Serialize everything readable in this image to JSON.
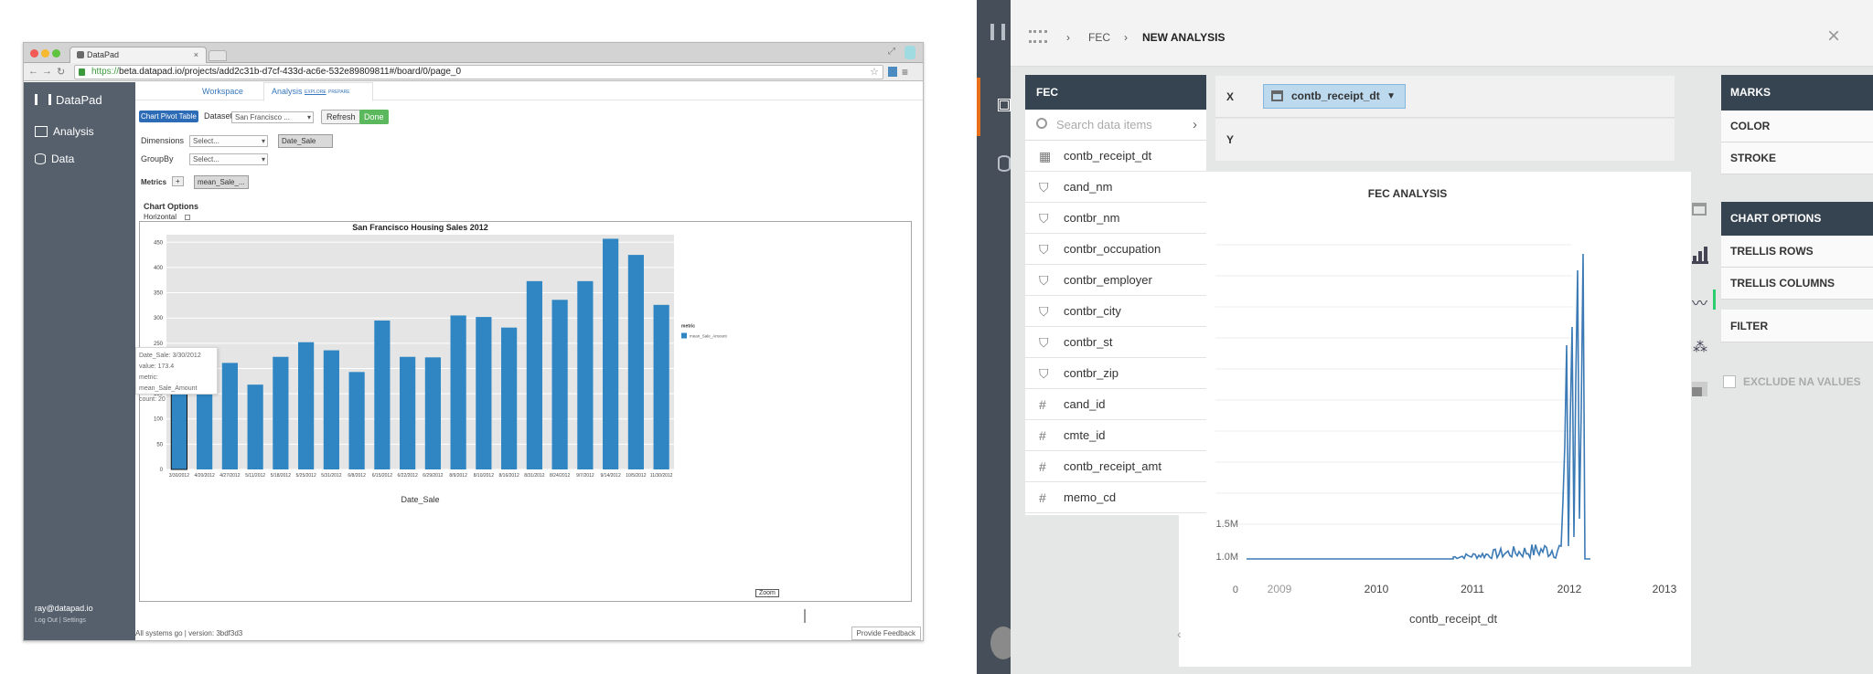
{
  "browser": {
    "tab_title": "DataPad",
    "url_prefix": "https://",
    "url": "beta.datapad.io/projects/add2c31b-d7cf-433d-ac6e-532e89809811#/board/0/page_0"
  },
  "datapad": {
    "logo_text": "DataPad",
    "nav": [
      {
        "label": "Analysis",
        "icon": "chart-icon"
      },
      {
        "label": "Data",
        "icon": "database-icon"
      }
    ],
    "tabs": {
      "workspace": "Workspace",
      "analysis": "Analysis",
      "explore": "EXPLORE",
      "prepare": "PREPARE"
    },
    "mode": {
      "chart_pivot_table": "Chart Pivot Table",
      "dataset_label": "Dataset",
      "dataset_value": "San Francisco ...",
      "refresh": "Refresh",
      "done": "Done"
    },
    "dimensions": {
      "label": "Dimensions",
      "select": "Select...",
      "chip": "Date_Sale"
    },
    "groupby": {
      "label": "GroupBy",
      "select": "Select..."
    },
    "metrics": {
      "label": "Metrics",
      "add": "+",
      "chip": "mean_Sale_..."
    },
    "chart_options": {
      "label": "Chart Options",
      "horizontal": "Horizontal"
    },
    "user": {
      "email": "ray@datapad.io",
      "logout": "Log Out",
      "settings": "Settings"
    },
    "status": "All systems go | version: 3bdf3d3",
    "feedback": "Provide Feedback",
    "zoom": "Zoom",
    "tooltip": {
      "line1": "Date_Sale: 3/30/2012",
      "line2": "value: 173.4",
      "line3": "metric: mean_Sale_Amount",
      "line4": "count: 20"
    },
    "colors": {
      "bar": "#2f86c3",
      "sidebar": "#56606d",
      "done": "#5cb85c",
      "active": "#2c6cb7"
    }
  },
  "chart_data": [
    {
      "type": "bar",
      "title": "San Francisco Housing Sales 2012",
      "xlabel": "Date_Sale",
      "ylabel": "",
      "categories": [
        "3/30/2012",
        "4/20/2012",
        "4/27/2012",
        "5/11/2012",
        "5/18/2012",
        "5/25/2012",
        "5/31/2012",
        "6/8/2012",
        "6/15/2012",
        "6/22/2012",
        "6/29/2012",
        "8/9/2012",
        "8/10/2012",
        "8/16/2012",
        "8/31/2012",
        "8/24/2012",
        "9/7/2012",
        "9/14/2012",
        "10/5/2012",
        "11/30/2012"
      ],
      "values": [
        173.4,
        218,
        211,
        168,
        223,
        252,
        236,
        193,
        295,
        223,
        222,
        305,
        302,
        281,
        373,
        336,
        373,
        457,
        425,
        326
      ],
      "ylim": [
        0,
        465
      ],
      "yticks": [
        0,
        50,
        100,
        150,
        200,
        250,
        300,
        350,
        400,
        450
      ],
      "grid": true,
      "legend": {
        "title": "metric",
        "entries": [
          "mean_Sale_Amount"
        ],
        "position": "right"
      }
    },
    {
      "type": "line",
      "title": "FEC ANALYSIS",
      "xlabel": "contb_receipt_dt",
      "ylabel": "",
      "xticks": [
        "2009",
        "2010",
        "2011",
        "2012",
        "2013"
      ],
      "yticks_visible": [
        "0",
        "1.0M",
        "1.5M"
      ],
      "series": [
        {
          "values_note_free": true
        }
      ]
    }
  ],
  "fec": {
    "breadcrumb": {
      "root": "FEC",
      "current": "NEW ANALYSIS"
    },
    "close": "×",
    "panel_title": "FEC",
    "search_placeholder": "Search data items",
    "fields": [
      {
        "name": "contb_receipt_dt",
        "type": "date"
      },
      {
        "name": "cand_nm",
        "type": "category"
      },
      {
        "name": "contbr_nm",
        "type": "category"
      },
      {
        "name": "contbr_occupation",
        "type": "category"
      },
      {
        "name": "contbr_employer",
        "type": "category"
      },
      {
        "name": "contbr_city",
        "type": "category"
      },
      {
        "name": "contbr_st",
        "type": "category"
      },
      {
        "name": "contbr_zip",
        "type": "category"
      },
      {
        "name": "cand_id",
        "type": "number"
      },
      {
        "name": "cmte_id",
        "type": "number"
      },
      {
        "name": "contb_receipt_amt",
        "type": "number"
      },
      {
        "name": "memo_cd",
        "type": "number"
      }
    ],
    "x_label": "X",
    "y_label": "Y",
    "x_field": "contb_receipt_dt",
    "marks": "MARKS",
    "color": "COLOR",
    "stroke": "STROKE",
    "chart_options": "CHART OPTIONS",
    "trellis_rows": "TRELLIS ROWS",
    "trellis_columns": "TRELLIS COLUMNS",
    "filter": "FILTER",
    "exclude_na": "EXCLUDE NA VALUES",
    "colors": {
      "header": "#364452",
      "line": "#3b7ab5",
      "pill": "#bcd9ee",
      "accent": "#2ecc71",
      "orange": "#e8701a"
    }
  }
}
